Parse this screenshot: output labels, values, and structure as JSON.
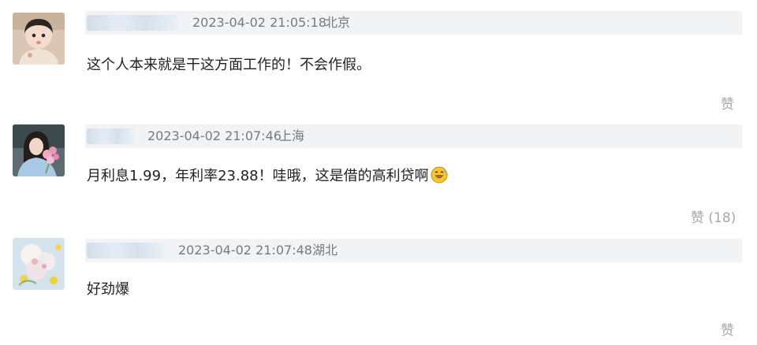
{
  "comments": [
    {
      "timestamp": "2023-04-02 21:05:18",
      "location": "北京",
      "text": "这个人本来就是干这方面工作的！不会作假。",
      "like_label": "赞",
      "like_count": ""
    },
    {
      "timestamp": "2023-04-02 21:07:46",
      "location": "上海",
      "text": "月利息1.99，年利率23.88！哇哦，这是借的高利贷啊",
      "like_label": "赞",
      "like_count": "(18)",
      "emoji": "sweat-smile-emoji"
    },
    {
      "timestamp": "2023-04-02 21:07:48",
      "location": "湖北",
      "text": "好劲爆",
      "like_label": "赞",
      "like_count": ""
    }
  ],
  "colors": {
    "meta_bar": "#f2f3f4",
    "meta_text": "#777b80",
    "body_text": "#222222",
    "like_text": "#a4a8ad"
  }
}
